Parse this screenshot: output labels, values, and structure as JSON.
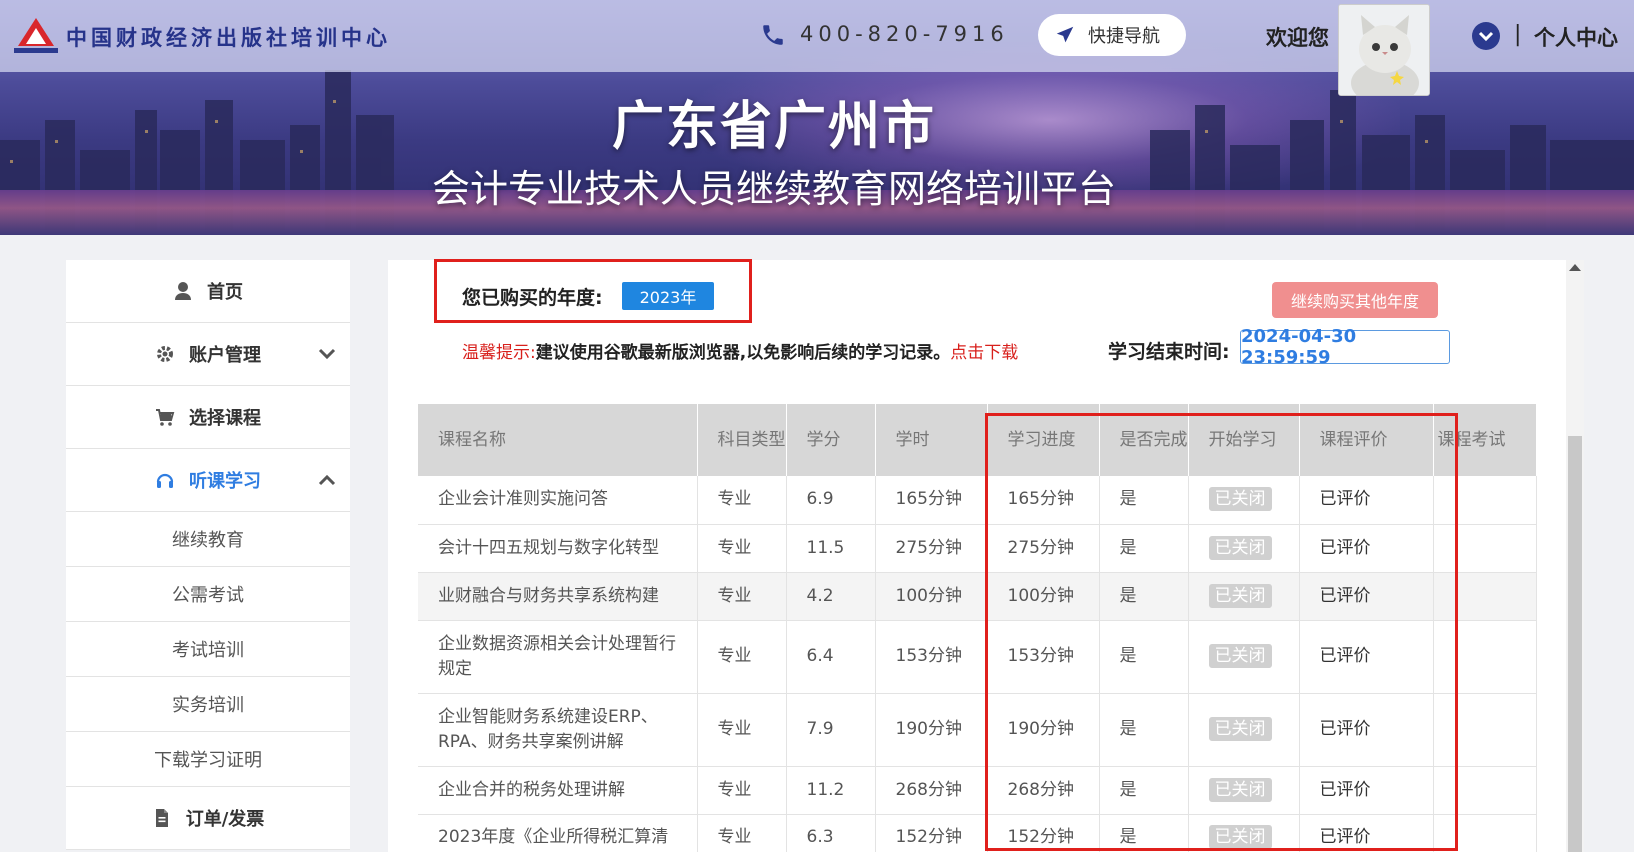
{
  "header": {
    "site_name": "中国财政经济出版社培训中心",
    "phone": "400-820-7916",
    "quick_nav": "快捷导航",
    "welcome": "欢迎您",
    "separator": "|",
    "personal_center": "个人中心"
  },
  "banner": {
    "title": "广东省广州市",
    "subtitle": "会计专业技术人员继续教育网络培训平台"
  },
  "sidebar": {
    "items": [
      {
        "label": "首页",
        "icon": "user-icon"
      },
      {
        "label": "账户管理",
        "icon": "gear-icon"
      },
      {
        "label": "选择课程",
        "icon": "cart-icon"
      },
      {
        "label": "听课学习",
        "icon": "headphones-icon"
      },
      {
        "label": "订单/发票",
        "icon": "document-icon"
      }
    ],
    "sub_items": [
      "继续教育",
      "公需考试",
      "考试培训",
      "实务培训",
      "下载学习证明"
    ]
  },
  "main": {
    "purchased_year_label": "您已购买的年度:",
    "purchased_year": "2023年",
    "buy_more": "继续购买其他年度",
    "tip_prefix": "温馨提示:",
    "tip_text": "建议使用谷歌最新版浏览器,以免影响后续的学习记录。",
    "tip_link": "点击下载",
    "end_time_label": "学习结束时间:",
    "end_time": "2024-04-30 23:59:59"
  },
  "table": {
    "headers": [
      "课程名称",
      "科目类型",
      "学分",
      "学时",
      "学习进度",
      "是否完成",
      "开始学习",
      "课程评价",
      "课程考试"
    ],
    "rows": [
      [
        "企业会计准则实施问答",
        "专业",
        "6.9",
        "165分钟",
        "165分钟",
        "是",
        "已关闭",
        "已评价"
      ],
      [
        "会计十四五规划与数字化转型",
        "专业",
        "11.5",
        "275分钟",
        "275分钟",
        "是",
        "已关闭",
        "已评价"
      ],
      [
        "业财融合与财务共享系统构建",
        "专业",
        "4.2",
        "100分钟",
        "100分钟",
        "是",
        "已关闭",
        "已评价"
      ],
      [
        "企业数据资源相关会计处理暂行规定",
        "专业",
        "6.4",
        "153分钟",
        "153分钟",
        "是",
        "已关闭",
        "已评价"
      ],
      [
        "企业智能财务系统建设ERP、RPA、财务共享案例讲解",
        "专业",
        "7.9",
        "190分钟",
        "190分钟",
        "是",
        "已关闭",
        "已评价"
      ],
      [
        "企业合并的税务处理讲解",
        "专业",
        "11.2",
        "268分钟",
        "268分钟",
        "是",
        "已关闭",
        "已评价"
      ],
      [
        "2023年度《企业所得税汇算清",
        "专业",
        "6.3",
        "152分钟",
        "152分钟",
        "是",
        "已关闭",
        "已评价"
      ]
    ]
  },
  "colors": {
    "accent": "#2f7de1",
    "highlight_box": "#e0201c",
    "buy_more_bg": "#f08f8f"
  }
}
